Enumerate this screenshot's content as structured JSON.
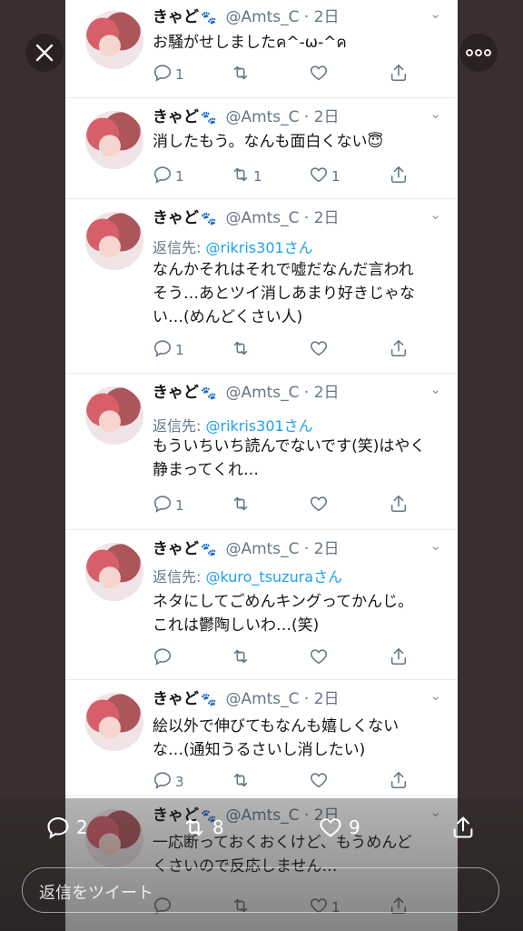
{
  "tweets": [
    {
      "name": "きゃど",
      "handle": "@Amts_C · 2日",
      "reply_prefix": "",
      "reply_mention": "",
      "reply_suffix": "",
      "text": "お騒がせしましたค^-ω-^ค",
      "replies": "1",
      "retweets": "",
      "likes": ""
    },
    {
      "name": "きゃど",
      "handle": "@Amts_C · 2日",
      "reply_prefix": "",
      "reply_mention": "",
      "reply_suffix": "",
      "text": "消したもう。なんも面白くない😇",
      "replies": "1",
      "retweets": "1",
      "likes": "1"
    },
    {
      "name": "きゃど",
      "handle": "@Amts_C · 2日",
      "reply_prefix": "返信先: ",
      "reply_mention": "@rikris301",
      "reply_suffix": "さん",
      "text": "なんかそれはそれで嘘だなんだ言われ\nそう…あとツイ消しあまり好きじゃな\nい…(めんどくさい人)",
      "replies": "1",
      "retweets": "",
      "likes": ""
    },
    {
      "name": "きゃど",
      "handle": "@Amts_C · 2日",
      "reply_prefix": "返信先: ",
      "reply_mention": "@rikris301",
      "reply_suffix": "さん",
      "text": "もういちいち読んでないです(笑)はやく\n静まってくれ…",
      "replies": "1",
      "retweets": "",
      "likes": ""
    },
    {
      "name": "きゃど",
      "handle": "@Amts_C · 2日",
      "reply_prefix": "返信先: ",
      "reply_mention": "@kuro_tsuzura",
      "reply_suffix": "さん",
      "text": "ネタにしてごめんキングってかんじ。\nこれは鬱陶しいわ…(笑)",
      "replies": "",
      "retweets": "",
      "likes": ""
    },
    {
      "name": "きゃど",
      "handle": "@Amts_C · 2日",
      "reply_prefix": "",
      "reply_mention": "",
      "reply_suffix": "",
      "text": "絵以外で伸びてもなんも嬉しくない\nな…(通知うるさいし消したい)",
      "replies": "3",
      "retweets": "",
      "likes": ""
    },
    {
      "name": "きゃど",
      "handle": "@Amts_C · 2日",
      "reply_prefix": "",
      "reply_mention": "",
      "reply_suffix": "",
      "text": "一応断っておくおくけど、もうめんど\nくさいので反応しません…",
      "replies": "",
      "retweets": "",
      "likes": "1"
    }
  ],
  "bottom": {
    "replies": "2",
    "retweets": "8",
    "likes": "9",
    "reply_placeholder": "返信をツイート"
  },
  "colors": {
    "link": "#1da1f2",
    "muted": "#657786",
    "background": "#3a2f2e"
  }
}
